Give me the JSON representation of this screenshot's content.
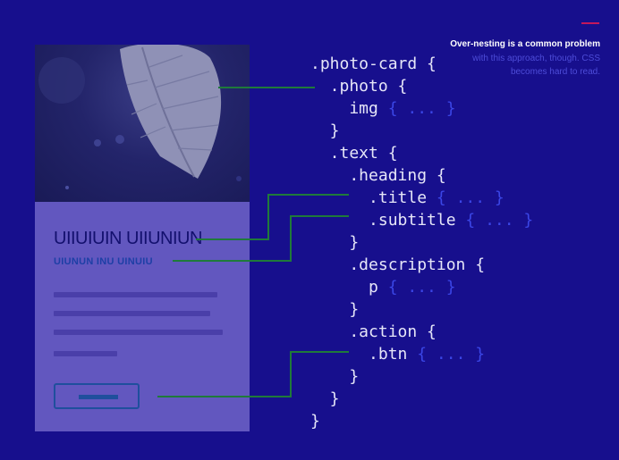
{
  "card": {
    "title": "UIIUIUIN UIIUNIUN",
    "subtitle": "UIUNUN INU UINUIU"
  },
  "code": {
    "lines": [
      ".photo-card {",
      "  .photo {",
      "    img",
      "  }",
      "  .text {",
      "    .heading {",
      "      .title",
      "      .subtitle",
      "    }",
      "    .description {",
      "      p",
      "    }",
      "    .action {",
      "      .btn",
      "    }",
      "  }",
      "}"
    ],
    "placeholder": "{ ... }"
  },
  "note": {
    "strong": "Over-nesting is a common problem",
    "light": "with this approach, though. CSS becomes hard to read."
  },
  "colors": {
    "background": "#170f8d",
    "card": "#6257bf",
    "connector": "#1f7a3a",
    "accent_rule": "#c2185b"
  }
}
